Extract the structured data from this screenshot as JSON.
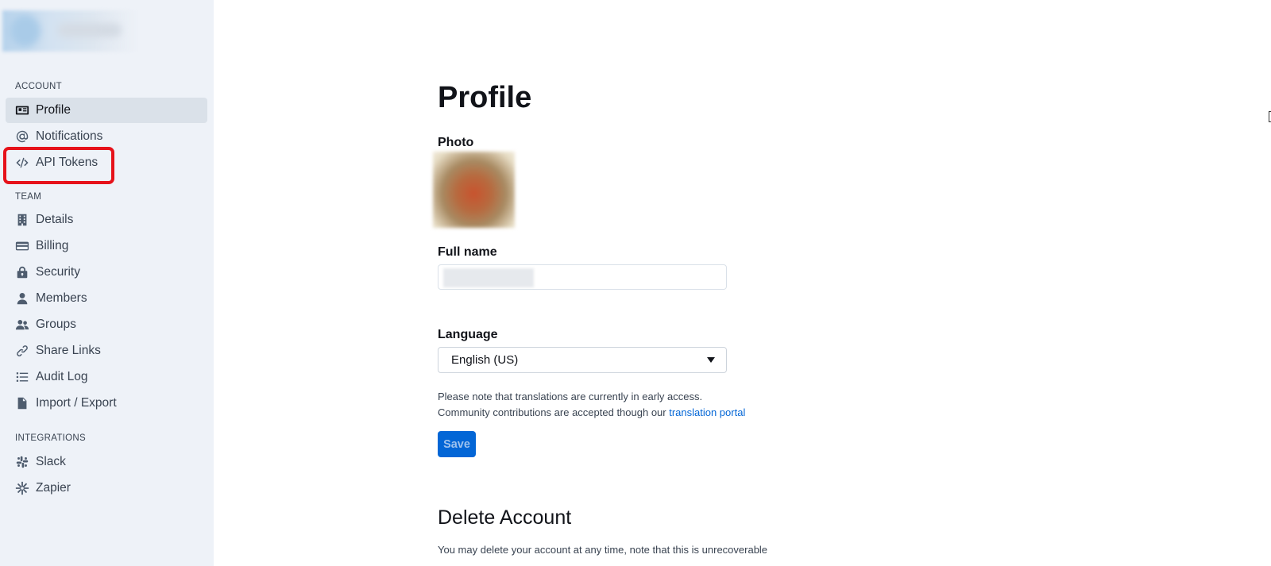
{
  "sidebar": {
    "sections": {
      "account": "ACCOUNT",
      "team": "TEAM",
      "integrations": "INTEGRATIONS"
    },
    "account_items": [
      {
        "label": "Profile",
        "icon": "profile-card-icon",
        "active": true
      },
      {
        "label": "Notifications",
        "icon": "at-sign-icon"
      },
      {
        "label": "API Tokens",
        "icon": "code-icon",
        "highlighted": true
      }
    ],
    "team_items": [
      {
        "label": "Details",
        "icon": "building-icon"
      },
      {
        "label": "Billing",
        "icon": "credit-card-icon"
      },
      {
        "label": "Security",
        "icon": "lock-icon"
      },
      {
        "label": "Members",
        "icon": "user-icon"
      },
      {
        "label": "Groups",
        "icon": "users-icon"
      },
      {
        "label": "Share Links",
        "icon": "link-icon"
      },
      {
        "label": "Audit Log",
        "icon": "list-icon"
      },
      {
        "label": "Import / Export",
        "icon": "file-icon"
      }
    ],
    "integration_items": [
      {
        "label": "Slack",
        "icon": "slack-icon"
      },
      {
        "label": "Zapier",
        "icon": "zapier-icon"
      }
    ]
  },
  "profile": {
    "title": "Profile",
    "photo_label": "Photo",
    "full_name_label": "Full name",
    "full_name_value": "",
    "language_label": "Language",
    "language_value": "English (US)",
    "note_line1": "Please note that translations are currently in early access.",
    "note_line2": "Community contributions are accepted though our ",
    "note_link": "translation portal",
    "save_label": "Save"
  },
  "delete_account": {
    "title": "Delete Account",
    "description": "You may delete your account at any time, note that this is unrecoverable"
  },
  "colors": {
    "accent": "#0366d6",
    "sidebar_bg": "#eef2f8",
    "active_item_bg": "#dae1e9",
    "highlight": "#e6121a"
  }
}
